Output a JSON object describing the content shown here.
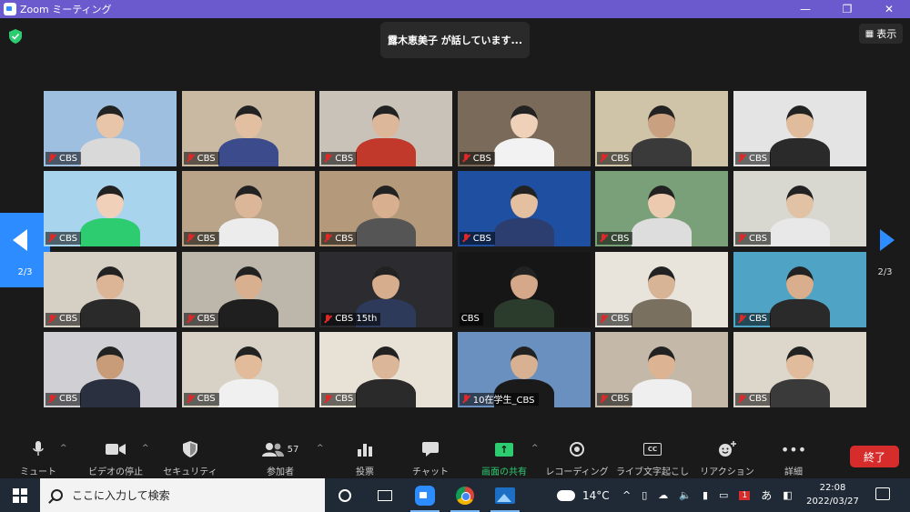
{
  "window": {
    "title": "Zoom ミーティング",
    "min": "—",
    "max": "❐",
    "close": "✕"
  },
  "meeting": {
    "speaking_text": "露木恵美子 が話しています...",
    "view_label": "表示",
    "page_left": "2/3",
    "page_right": "2/3"
  },
  "participants": [
    {
      "name": "CBS",
      "muted": true,
      "bg": "#9fbfe0",
      "skin": "#e8c4a8",
      "shirt": "#d9d9d9"
    },
    {
      "name": "CBS",
      "muted": true,
      "bg": "#c9b9a3",
      "skin": "#e2bfa0",
      "shirt": "#3b4b8c"
    },
    {
      "name": "CBS",
      "muted": true,
      "bg": "#c8c2b8",
      "skin": "#dcb79a",
      "shirt": "#c0392b"
    },
    {
      "name": "CBS",
      "muted": true,
      "bg": "#7a6a5a",
      "skin": "#efd0b8",
      "shirt": "#f2f2f2"
    },
    {
      "name": "CBS",
      "muted": true,
      "bg": "#cfc3a8",
      "skin": "#c9a080",
      "shirt": "#3a3a3a"
    },
    {
      "name": "CBS",
      "muted": true,
      "bg": "#e4e4e4",
      "skin": "#e0bc9c",
      "shirt": "#2a2a2a"
    },
    {
      "name": "CBS",
      "muted": true,
      "bg": "#a9d4ee",
      "skin": "#f0d0b8",
      "shirt": "#2ecc71"
    },
    {
      "name": "CBS",
      "muted": true,
      "bg": "#b9a48a",
      "skin": "#dcb698",
      "shirt": "#ececec"
    },
    {
      "name": "CBS",
      "muted": true,
      "bg": "#b49a7a",
      "skin": "#d8b090",
      "shirt": "#555555"
    },
    {
      "name": "CBS",
      "muted": true,
      "bg": "#1f4fa0",
      "skin": "#e4c0a0",
      "shirt": "#2c3e70"
    },
    {
      "name": "CBS",
      "muted": true,
      "bg": "#7aa07a",
      "skin": "#eccab0",
      "shirt": "#dddddd"
    },
    {
      "name": "CBS",
      "muted": true,
      "bg": "#d8d8d0",
      "skin": "#e2c2a4",
      "shirt": "#e8e8e8"
    },
    {
      "name": "CBS",
      "muted": true,
      "bg": "#d6cfc4",
      "skin": "#dcb496",
      "shirt": "#2a2a2a"
    },
    {
      "name": "CBS",
      "muted": true,
      "bg": "#bdb6aa",
      "skin": "#d8b090",
      "shirt": "#1f1f1f"
    },
    {
      "name": "CBS 15th",
      "muted": true,
      "bg": "#2b2b30",
      "skin": "#d6ae8e",
      "shirt": "#2d3a5a"
    },
    {
      "name": "CBS",
      "muted": false,
      "bg": "#161616",
      "skin": "#d4a888",
      "shirt": "#2c3c2c"
    },
    {
      "name": "CBS",
      "muted": true,
      "bg": "#e8e4dc",
      "skin": "#d8b496",
      "shirt": "#7a7060"
    },
    {
      "name": "CBS",
      "muted": true,
      "bg": "#4fa3c4",
      "skin": "#d8ae8c",
      "shirt": "#2a2a2a"
    },
    {
      "name": "CBS",
      "muted": true,
      "bg": "#cfcfd4",
      "skin": "#c89c78",
      "shirt": "#2a3040"
    },
    {
      "name": "CBS",
      "muted": true,
      "bg": "#d8d2c6",
      "skin": "#e2bc9a",
      "shirt": "#f0f0f0"
    },
    {
      "name": "CBS",
      "muted": true,
      "bg": "#e8e2d6",
      "skin": "#dcb698",
      "shirt": "#2a2a2a"
    },
    {
      "name": "10在学生_CBS",
      "muted": true,
      "bg": "#6a90c0",
      "skin": "#d8b092",
      "shirt": "#1a1a1a"
    },
    {
      "name": "CBS",
      "muted": true,
      "bg": "#c4b8a8",
      "skin": "#dcb494",
      "shirt": "#efefef"
    },
    {
      "name": "CBS",
      "muted": true,
      "bg": "#ddd6ca",
      "skin": "#e0bc9c",
      "shirt": "#3a3a3a"
    }
  ],
  "toolbar": {
    "mute": "ミュート",
    "video": "ビデオの停止",
    "security": "セキュリティ",
    "participants": "参加者",
    "participants_count": "57",
    "poll": "投票",
    "chat": "チャット",
    "share": "画面の共有",
    "record": "レコーディング",
    "captions": "ライブ文字起こし",
    "captions_icon_text": "CC",
    "reactions": "リアクション",
    "more": "詳細",
    "end": "終了"
  },
  "taskbar": {
    "search_placeholder": "ここに入力して検索",
    "temperature": "14°C",
    "ime": "あ",
    "time": "22:08",
    "date": "2022/03/27",
    "badge": "1"
  },
  "colors": {
    "zoom_blue": "#2d8cff",
    "share_green": "#2ecc71",
    "end_red": "#d72c2c",
    "titlebar": "#6a5acd"
  }
}
